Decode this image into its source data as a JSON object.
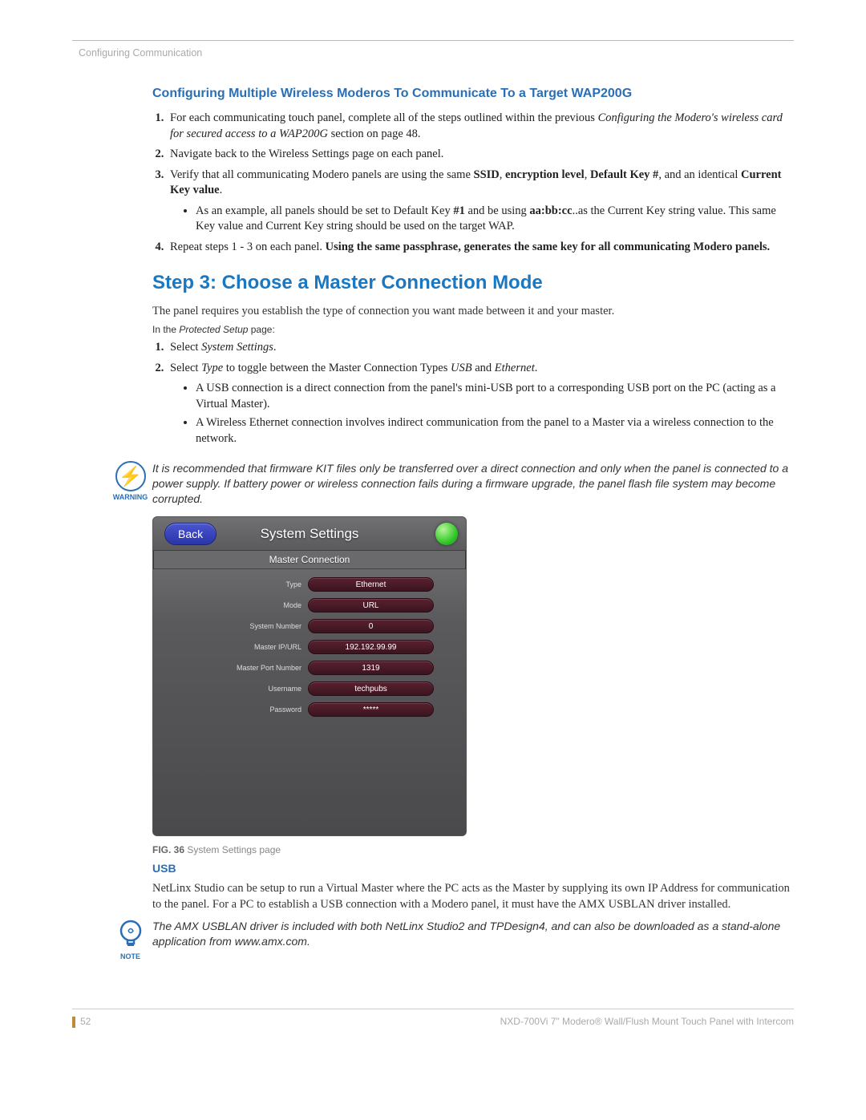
{
  "header": "Configuring Communication",
  "section1_title": "Configuring Multiple Wireless Moderos To Communicate To a Target WAP200G",
  "ol1_item1_a": "For each communicating touch panel, complete all of the steps outlined within the previous ",
  "ol1_item1_b": "Configuring the Modero's wireless card for secured access to a WAP200G",
  "ol1_item1_c": " section on page 48.",
  "ol1_item2": "Navigate back to the Wireless Settings page on each panel.",
  "ol1_item3_a": "Verify that all communicating Modero panels are using the same ",
  "ol1_item3_b": "SSID",
  "ol1_item3_c": "encryption level",
  "ol1_item3_d": "Default Key #",
  "ol1_item3_e": ", and an identical ",
  "ol1_item3_f": "Current Key value",
  "ol1_item3_g": ".",
  "ol1_bullet_a": "As an example, all panels should be set to Default Key ",
  "ol1_bullet_b": "#1",
  "ol1_bullet_c": " and be using ",
  "ol1_bullet_d": "aa:bb:cc",
  "ol1_bullet_e": "..as the Current Key string value. This same Key value and Current Key string should be used on the target WAP.",
  "ol1_item4_a": "Repeat steps 1 - 3 on each panel. ",
  "ol1_item4_b": "Using the same passphrase, generates the same key for all communicating Modero panels.",
  "step_heading": "Step 3: Choose a Master Connection Mode",
  "step_intro": "The panel requires you establish the type of connection you want made between it and your master.",
  "inthe_a": "In the ",
  "inthe_b": "Protected Setup",
  "inthe_c": " page:",
  "ol2_item1_a": "Select ",
  "ol2_item1_b": "System Settings",
  "ol2_item2_a": "Select ",
  "ol2_item2_b": "Type",
  "ol2_item2_c": " to toggle between the Master Connection Types ",
  "ol2_item2_d": "USB",
  "ol2_item2_e": " and ",
  "ol2_item2_f": "Ethernet",
  "ol2_item2_g": ".",
  "ol2_b1": "A USB connection is a direct connection from the panel's mini-USB port to a corresponding USB port on the PC (acting as a Virtual Master).",
  "ol2_b2": "A Wireless Ethernet connection involves indirect communication from the panel to a Master via a wireless connection to the network.",
  "warning_label": "WARNING",
  "warning_text": "It is recommended that firmware KIT files only be transferred over a direct connection and only when the panel is connected to a power supply. If battery power or wireless connection fails during a firmware upgrade, the panel flash file system may become corrupted.",
  "ss": {
    "back": "Back",
    "title": "System Settings",
    "sub": "Master Connection",
    "rows": [
      {
        "label": "Type",
        "value": "Ethernet"
      },
      {
        "label": "Mode",
        "value": "URL"
      },
      {
        "label": "System Number",
        "value": "0"
      },
      {
        "label": "Master IP/URL",
        "value": "192.192.99.99"
      },
      {
        "label": "Master Port Number",
        "value": "1319"
      },
      {
        "label": "Username",
        "value": "techpubs"
      },
      {
        "label": "Password",
        "value": "*****"
      }
    ]
  },
  "fig_prefix": "FIG. 36",
  "fig_text": "  System Settings page",
  "usb_heading": "USB",
  "usb_para": "NetLinx Studio can be setup to run a Virtual Master where the PC acts as the Master by supplying its own IP Address for communication to the panel. For a PC to establish a USB connection with a Modero panel, it must have the AMX USBLAN driver installed.",
  "note_label": "NOTE",
  "note_text": "The AMX USBLAN driver is included with both NetLinx Studio2 and TPDesign4, and can also be downloaded as a stand-alone application from www.amx.com.",
  "page_num": "52",
  "footer_text": "NXD-700Vi 7\" Modero® Wall/Flush Mount Touch Panel with Intercom"
}
